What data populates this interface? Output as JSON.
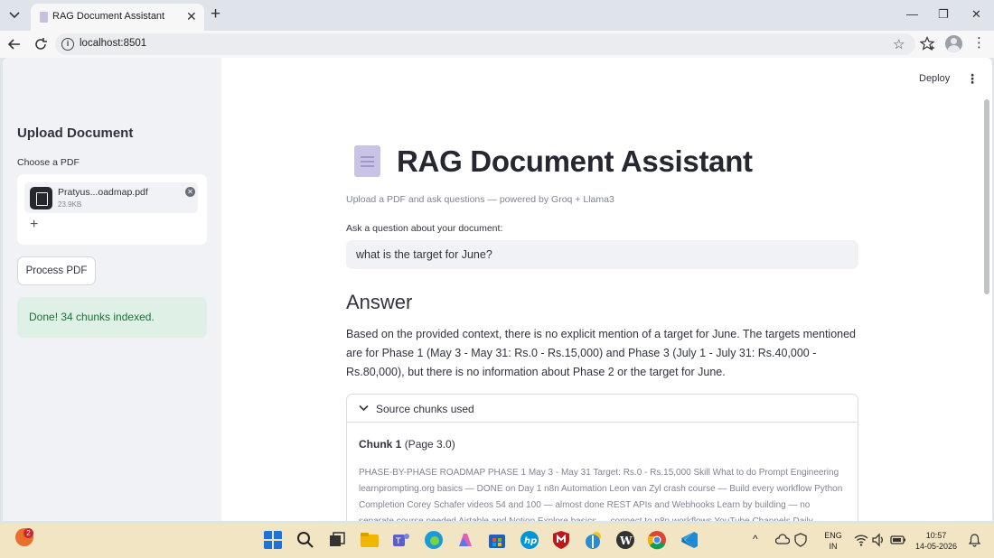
{
  "browser": {
    "tab_title": "RAG Document Assistant",
    "url": "localhost:8501"
  },
  "sidebar": {
    "title": "Upload Document",
    "choose_label": "Choose a PDF",
    "file": {
      "name": "Pratyus...oadmap.pdf",
      "size": "23.9KB"
    },
    "process_button": "Process PDF",
    "status": "Done! 34 chunks indexed."
  },
  "header": {
    "deploy_label": "Deploy"
  },
  "main": {
    "title": "RAG Document Assistant",
    "caption": "Upload a PDF and ask questions — powered by Groq + Llama3",
    "question_label": "Ask a question about your document:",
    "question_value": "what is the target for June?",
    "answer_heading": "Answer",
    "answer_text": "Based on the provided context, there is no explicit mention of a target for June. The targets mentioned are for Phase 1 (May 3 - May 31: Rs.0 - Rs.15,000) and Phase 3 (July 1 - July 31: Rs.40,000 - Rs.80,000), but there is no information about Phase 2 or the target for June.",
    "sources": {
      "title": "Source chunks used",
      "chunk_label": "Chunk 1",
      "chunk_page": "(Page 3.0)",
      "chunk_text": "PHASE-BY-PHASE ROADMAP PHASE 1 May 3 - May 31 Target: Rs.0 - Rs.15,000 Skill What to do Prompt Engineering learnprompting.org basics — DONE on Day 1 n8n Automation Leon van Zyl crash course — Build every workflow Python Completion Corey Schafer videos 54 and 100 — almost done REST APIs and Webhooks Learn by building — no separate course needed Airtable and Notion Explore basics — connect to n8n workflows YouTube Channels Daily"
    }
  },
  "taskbar": {
    "notification_count": "2",
    "language": "ENG",
    "region": "IN",
    "time": "10:57",
    "date": "14-05-2026"
  },
  "colors": {
    "sidebar_bg": "#f0f2f6",
    "success_bg": "#dff1e7",
    "success_text": "#177233",
    "taskbar_bg": "#f2e5c4"
  }
}
